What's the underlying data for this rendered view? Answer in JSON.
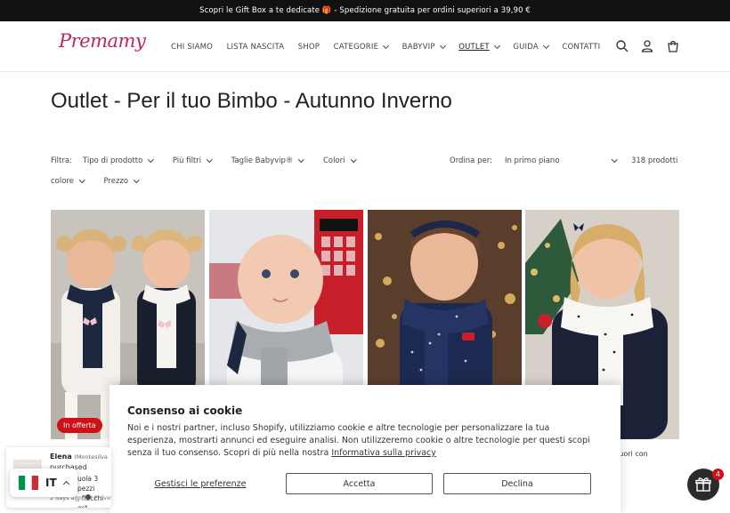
{
  "announcement": "Scopri le Gift Box a te dedicate 🎁 - Spedizione gratuita per ordini superiori a 39,90 €",
  "brand": {
    "logo_text": "Premamy",
    "color": "#c0245f"
  },
  "nav": [
    {
      "label": "CHI SIAMO",
      "dropdown": false
    },
    {
      "label": "LISTA NASCITA",
      "dropdown": false
    },
    {
      "label": "SHOP",
      "dropdown": false
    },
    {
      "label": "CATEGORIE",
      "dropdown": true
    },
    {
      "label": "BABYVIP",
      "dropdown": true
    },
    {
      "label": "OUTLET",
      "dropdown": true,
      "active": true
    },
    {
      "label": "GUIDA",
      "dropdown": true
    },
    {
      "label": "CONTATTI",
      "dropdown": false
    }
  ],
  "header_icons": [
    "search-icon",
    "account-icon",
    "cart-icon"
  ],
  "page_title": "Outlet - Per il tuo Bimbo - Autunno Inverno",
  "filters": {
    "label": "Filtra:",
    "row1": [
      "Tipo di prodotto",
      "Più filtri",
      "Taglie Babyvip®",
      "Colori"
    ],
    "row2": [
      "colore",
      "Prezzo"
    ],
    "sort_label": "Ordina per:",
    "sort_value": "In primo piano",
    "count": "318 prodotti"
  },
  "products": [
    {
      "badge": "In offerta",
      "image": "two girls with navy and white knit scarves"
    },
    {
      "badge": "",
      "image": "baby with grey scarf in front of red phone booth"
    },
    {
      "badge": "",
      "image": "girl with navy polka-dot scarf"
    },
    {
      "badge": "",
      "image": "girl with white polka-dot scarf",
      "caption": "pois cuori con"
    }
  ],
  "cookie": {
    "title": "Consenso ai cookie",
    "text": "Noi e i nostri partner, incluso Shopify, utilizziamo cookie e altre tecnologie per personalizzare la tua esperienza, mostrarti annunci ed eseguire analisi. Non utilizzeremo cookie o altre tecnologie per questi scopi senza il tuo consenso. Scopri di più nella nostra ",
    "link": "Informativa sulla privacy",
    "manage": "Gestisci le preferenze",
    "accept": "Accetta",
    "decline": "Declina"
  },
  "toast": {
    "name": "Elena",
    "location": "(Montesilva",
    "action": "purchased",
    "product_lines": [
      "uola 3 pezzi",
      ", fiocchi est"
    ],
    "time": "2 days ago",
    "verified": "ProveS"
  },
  "language": {
    "code": "IT"
  },
  "gift_widget": {
    "count": "4"
  },
  "colors": {
    "announcement_bg": "#111111",
    "badge": "#d10f16",
    "brand": "#c0245f"
  }
}
